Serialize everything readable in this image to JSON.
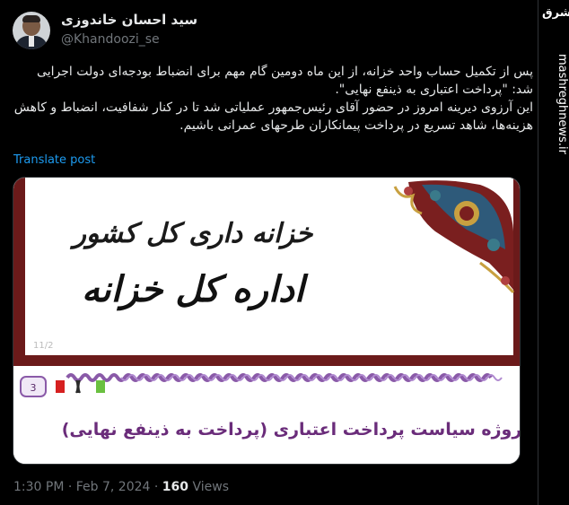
{
  "author": {
    "name": "سید احسان خاندوزی",
    "handle": "@Khandoozi_se"
  },
  "tweet": {
    "paragraphs": [
      "پس از تکمیل حساب واحد خزانه، از این ماه دومین گام مهم برای انضباط بودجه‌ای دولت اجرایی شد: \"پرداخت اعتباری به ذینفع نهایی\".",
      "این آرزوی دیرینه امروز در حضور آقای رئیس‌جمهور عملیاتی شد تا در کنار شفافیت، انضباط و کاهش هزینه‌ها، شاهد تسریع در پرداخت پیمانکاران طرحهای عمرانی باشیم."
    ],
    "translate_label": "Translate post",
    "time": "1:30 PM · Feb 7, 2024 · ",
    "views_count": "160",
    "views_label": " Views"
  },
  "card": {
    "line1": "خزانه داری کل کشور",
    "line2": "اداره کل خزانه",
    "slide_number": "3",
    "caption": "پروژه سیاست پرداخت اعتباری (پرداخت به ذینفع نهایی)",
    "corner_mark": "11/2"
  },
  "watermark": {
    "logo_text": "مشرق",
    "url": "mashreghnews.ir"
  },
  "colors": {
    "background": "#000000",
    "text": "#e7e9ea",
    "muted": "#71767b",
    "link": "#1d9bf0",
    "card_frame": "#6b1a1a",
    "caption_purple": "#6a2c7a"
  }
}
